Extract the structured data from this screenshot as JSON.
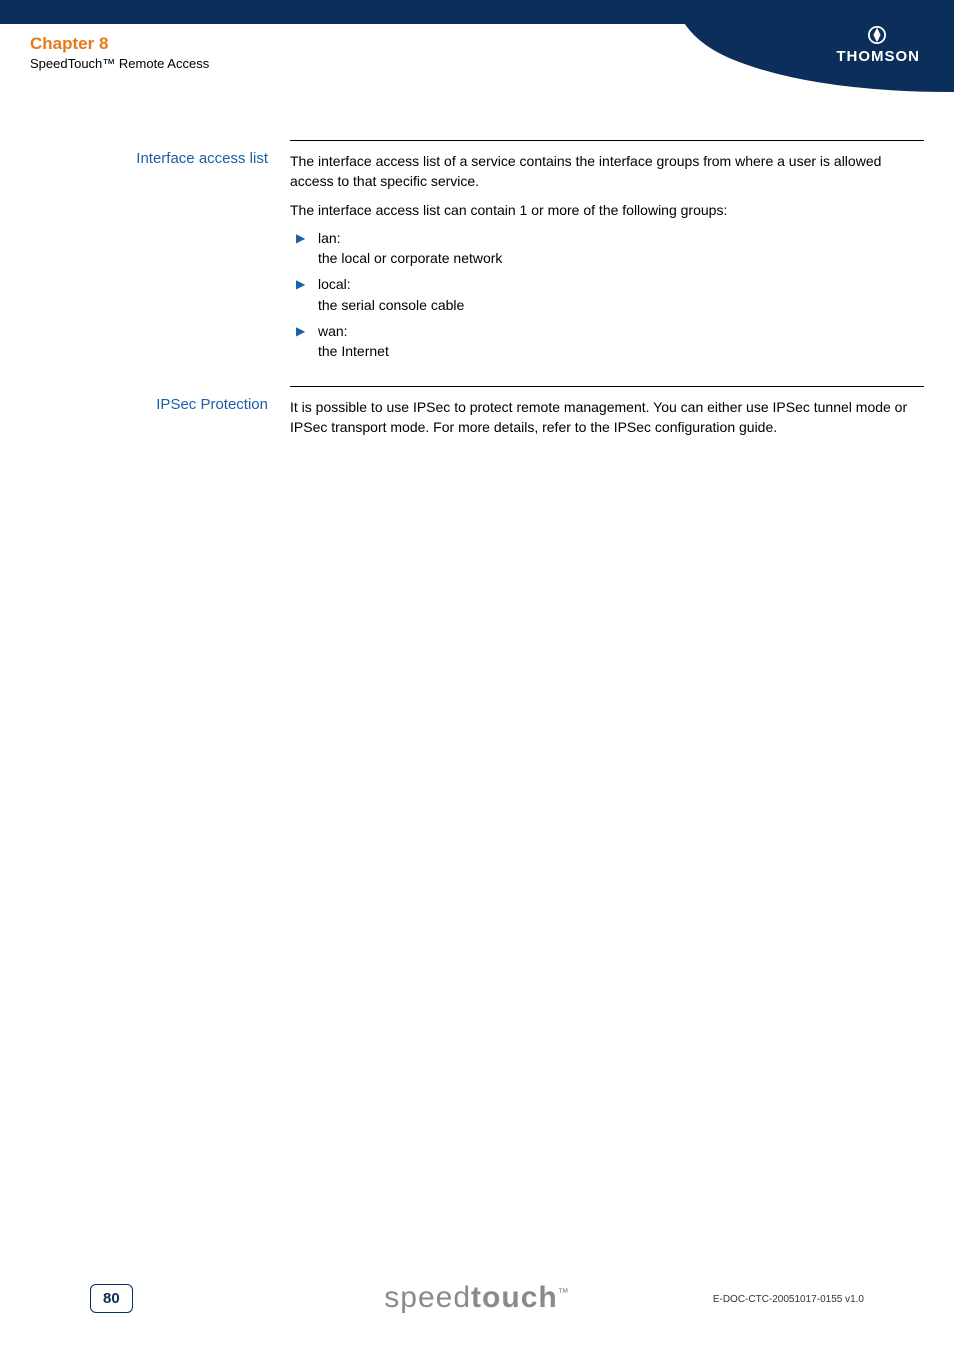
{
  "header": {
    "chapter": "Chapter 8",
    "subtitle": "SpeedTouch™ Remote Access"
  },
  "brand": {
    "name": "THOMSON"
  },
  "sections": [
    {
      "label": "Interface access list",
      "intro1": "The interface access list of a service contains the interface groups from where a user is allowed access to that specific service.",
      "intro2": "The interface access list can contain 1 or more of the following groups:",
      "items": [
        {
          "name": "lan:",
          "desc": "the local or corporate network"
        },
        {
          "name": "local:",
          "desc": "the serial console cable"
        },
        {
          "name": "wan:",
          "desc": "the Internet"
        }
      ]
    },
    {
      "label": "IPSec Protection",
      "intro1": "It is possible to use IPSec to protect remote management. You can either use IPSec tunnel mode or IPSec transport mode. For more details, refer to the IPSec configuration guide."
    }
  ],
  "footer": {
    "page": "80",
    "logo_light": "speed",
    "logo_bold": "touch",
    "logo_tm": "™",
    "docid": "E-DOC-CTC-20051017-0155 v1.0"
  }
}
